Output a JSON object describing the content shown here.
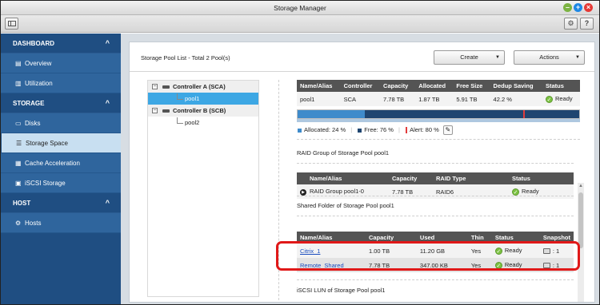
{
  "window": {
    "title": "Storage Manager"
  },
  "toolbar": {
    "help_label": "?"
  },
  "sidebar": {
    "sections": [
      {
        "label": "DASHBOARD",
        "items": [
          {
            "label": "Overview",
            "icon": "overview-icon"
          },
          {
            "label": "Utilization",
            "icon": "chart-icon"
          }
        ]
      },
      {
        "label": "STORAGE",
        "items": [
          {
            "label": "Disks",
            "icon": "disk-icon"
          },
          {
            "label": "Storage Space",
            "icon": "storage-icon",
            "active": true
          },
          {
            "label": "Cache Acceleration",
            "icon": "cache-icon"
          },
          {
            "label": "iSCSI Storage",
            "icon": "iscsi-icon"
          }
        ]
      },
      {
        "label": "HOST",
        "items": [
          {
            "label": "Hosts",
            "icon": "gear-icon"
          }
        ]
      }
    ]
  },
  "main": {
    "panel_title": "Storage Pool List - Total 2 Pool(s)",
    "create_label": "Create",
    "actions_label": "Actions",
    "tree": {
      "controller_a": "Controller A (SCA)",
      "pool_a": "pool1",
      "controller_b": "Controller B (SCB)",
      "pool_b": "pool2"
    },
    "pool_table": {
      "headers": [
        "Name/Alias",
        "Controller",
        "Capacity",
        "Allocated",
        "Free Size",
        "Dedup Saving",
        "Status"
      ],
      "row": {
        "name": "pool1",
        "controller": "SCA",
        "capacity": "7.78 TB",
        "allocated": "1.87 TB",
        "free": "5.91 TB",
        "dedup": "42.2 %",
        "status": "Ready"
      }
    },
    "usage": {
      "allocated_pct": 24,
      "alert_pct": 80,
      "allocated_label": "Allocated: 24 %",
      "free_label": "Free: 76 %",
      "alert_label": "Alert: 80 %",
      "allocated_color": "#3f8bcb",
      "free_color": "#1f4570",
      "alert_color": "#e23b3b"
    },
    "raid": {
      "title": "RAID Group of Storage Pool pool1",
      "headers": [
        "Name/Alias",
        "Capacity",
        "RAID Type",
        "Status"
      ],
      "row": {
        "name": "RAID Group pool1-0",
        "capacity": "7.78 TB",
        "type": "RAID6",
        "status": "Ready"
      }
    },
    "shared": {
      "title": "Shared Folder of Storage Pool pool1",
      "headers": [
        "Name/Alias",
        "Capacity",
        "Used",
        "Thin",
        "Status",
        "Snapshot"
      ],
      "rows": [
        {
          "name": "Citrix_1",
          "capacity": "1.00 TB",
          "used": "11.20 GB",
          "thin": "Yes",
          "status": "Ready",
          "snapshot": ": 1"
        },
        {
          "name": "Remote_Shared",
          "capacity": "7.78 TB",
          "used": "347.00 KB",
          "thin": "Yes",
          "status": "Ready",
          "snapshot": ": 1"
        }
      ]
    },
    "iscsi_title": "iSCSI LUN of Storage Pool pool1"
  }
}
